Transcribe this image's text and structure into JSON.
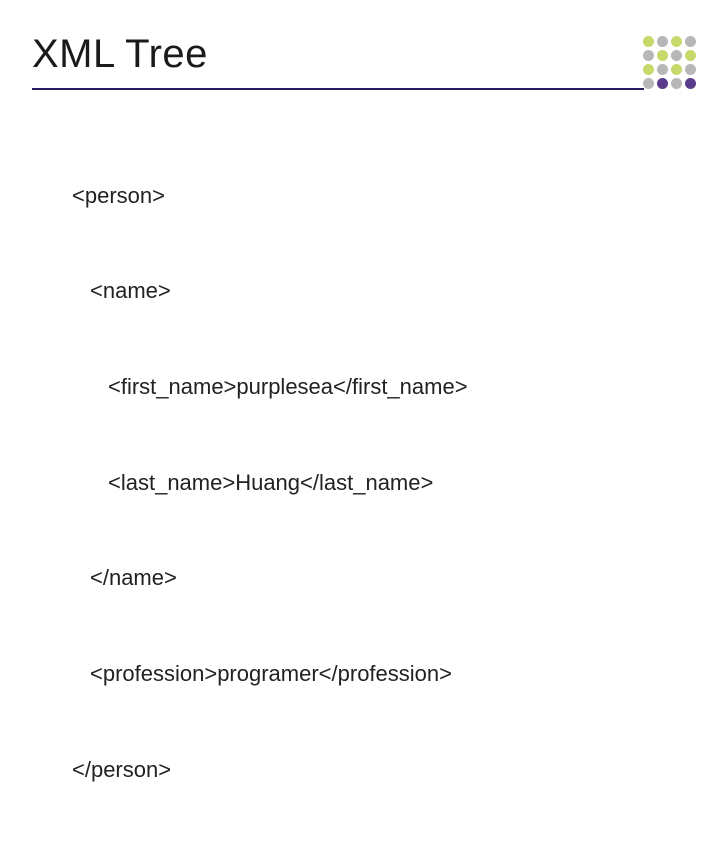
{
  "title": "XML  Tree",
  "dots": {
    "colors": [
      "#c6d96a",
      "#b7b7b7",
      "#c6d96a",
      "#b7b7b7",
      "#b7b7b7",
      "#c6d96a",
      "#b7b7b7",
      "#c6d96a",
      "#c6d96a",
      "#b7b7b7",
      "#c6d96a",
      "#b7b7b7",
      "#b7b7b7",
      "#5a3b8c",
      "#b7b7b7",
      "#5a3b8c"
    ]
  },
  "xml": {
    "l0": "<person>",
    "l1": "<name>",
    "l2": "<first_name>purplesea</first_name>",
    "l3": "<last_name>Huang</last_name>",
    "l4": "</name>",
    "l5": "<profession>programer</profession>",
    "l6": "</person>"
  }
}
